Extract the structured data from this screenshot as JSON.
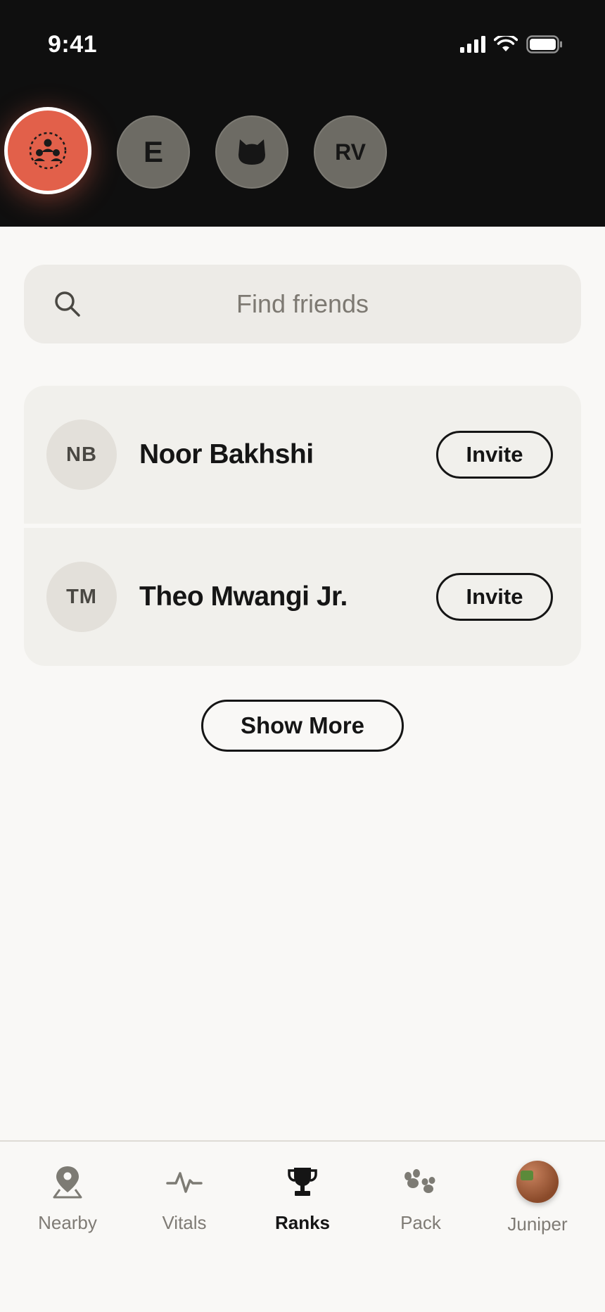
{
  "status_bar": {
    "time": "9:41"
  },
  "stories": [
    {
      "id": "group",
      "label": ""
    },
    {
      "id": "e",
      "label": "E"
    },
    {
      "id": "cat",
      "label": ""
    },
    {
      "id": "rv",
      "label": "RV"
    }
  ],
  "search": {
    "placeholder": "Find friends"
  },
  "friends": [
    {
      "initials": "NB",
      "name": "Noor Bakhshi",
      "action": "Invite"
    },
    {
      "initials": "TM",
      "name": "Theo Mwangi Jr.",
      "action": "Invite"
    }
  ],
  "show_more_label": "Show More",
  "tabs": [
    {
      "label": "Nearby",
      "icon": "map-pin-icon",
      "active": false
    },
    {
      "label": "Vitals",
      "icon": "pulse-icon",
      "active": false
    },
    {
      "label": "Ranks",
      "icon": "trophy-icon",
      "active": true
    },
    {
      "label": "Pack",
      "icon": "paw-icon",
      "active": false
    },
    {
      "label": "Juniper",
      "icon": "profile-avatar",
      "active": false
    }
  ],
  "colors": {
    "accent": "#e2604a",
    "header_bg": "#0f0f0f",
    "page_bg": "#f9f8f6",
    "card_bg": "#f1f0ec"
  }
}
